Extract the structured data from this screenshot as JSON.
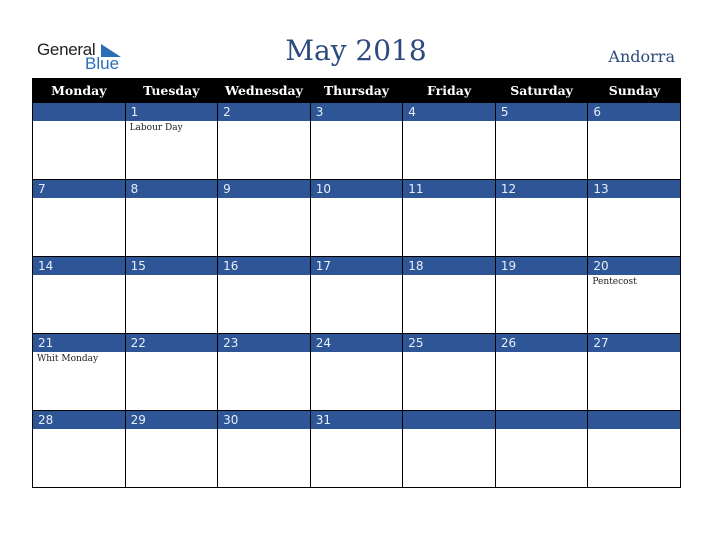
{
  "logo": {
    "general": "General",
    "blue": "Blue"
  },
  "title": "May 2018",
  "country": "Andorra",
  "colors": {
    "band": "#2e5596",
    "header": "#000000",
    "title": "#2c4a7e"
  },
  "weekdays": [
    "Monday",
    "Tuesday",
    "Wednesday",
    "Thursday",
    "Friday",
    "Saturday",
    "Sunday"
  ],
  "weeks": [
    [
      {
        "d": "",
        "e": ""
      },
      {
        "d": "1",
        "e": "Labour Day"
      },
      {
        "d": "2",
        "e": ""
      },
      {
        "d": "3",
        "e": ""
      },
      {
        "d": "4",
        "e": ""
      },
      {
        "d": "5",
        "e": ""
      },
      {
        "d": "6",
        "e": ""
      }
    ],
    [
      {
        "d": "7",
        "e": ""
      },
      {
        "d": "8",
        "e": ""
      },
      {
        "d": "9",
        "e": ""
      },
      {
        "d": "10",
        "e": ""
      },
      {
        "d": "11",
        "e": ""
      },
      {
        "d": "12",
        "e": ""
      },
      {
        "d": "13",
        "e": ""
      }
    ],
    [
      {
        "d": "14",
        "e": ""
      },
      {
        "d": "15",
        "e": ""
      },
      {
        "d": "16",
        "e": ""
      },
      {
        "d": "17",
        "e": ""
      },
      {
        "d": "18",
        "e": ""
      },
      {
        "d": "19",
        "e": ""
      },
      {
        "d": "20",
        "e": "Pentecost"
      }
    ],
    [
      {
        "d": "21",
        "e": "Whit Monday"
      },
      {
        "d": "22",
        "e": ""
      },
      {
        "d": "23",
        "e": ""
      },
      {
        "d": "24",
        "e": ""
      },
      {
        "d": "25",
        "e": ""
      },
      {
        "d": "26",
        "e": ""
      },
      {
        "d": "27",
        "e": ""
      }
    ],
    [
      {
        "d": "28",
        "e": ""
      },
      {
        "d": "29",
        "e": ""
      },
      {
        "d": "30",
        "e": ""
      },
      {
        "d": "31",
        "e": ""
      },
      {
        "d": "",
        "e": ""
      },
      {
        "d": "",
        "e": ""
      },
      {
        "d": "",
        "e": ""
      }
    ]
  ]
}
